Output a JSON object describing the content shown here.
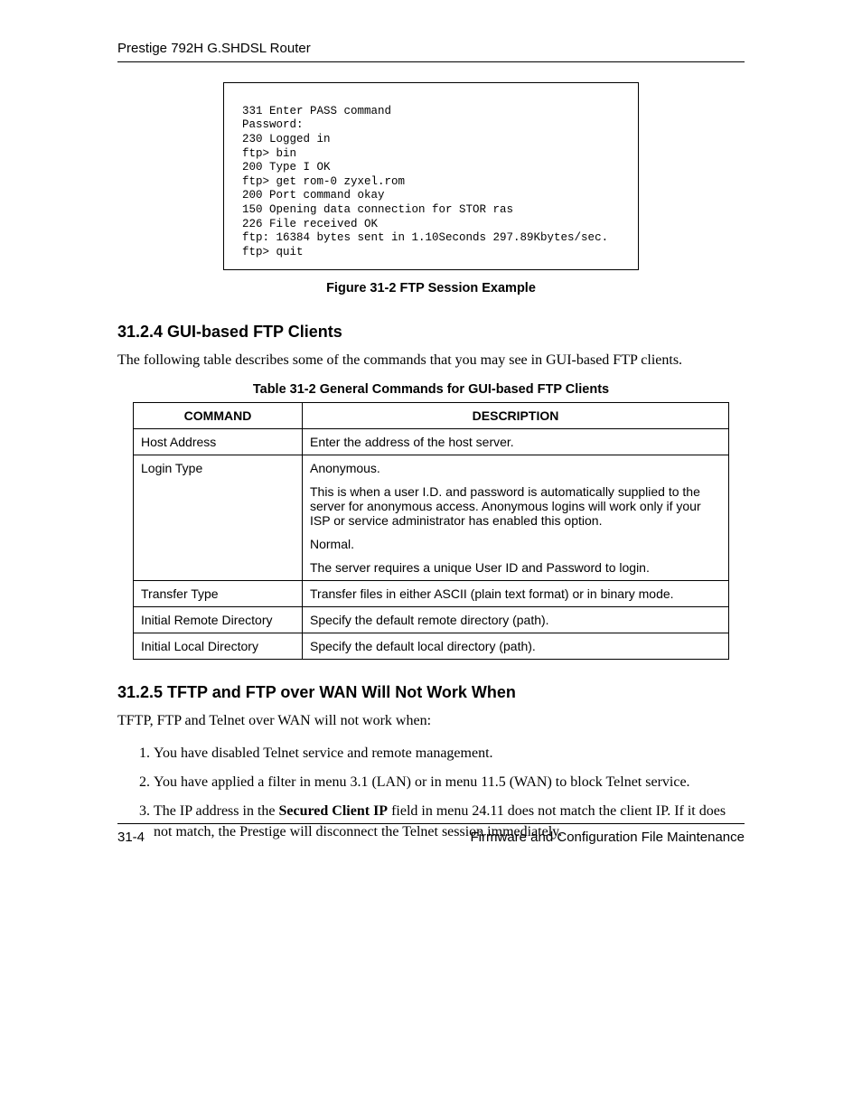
{
  "header": {
    "running_title": "Prestige 792H G.SHDSL Router"
  },
  "code_block": {
    "lines": [
      "331 Enter PASS command",
      "Password:",
      "230 Logged in",
      "ftp> bin",
      "200 Type I OK",
      "ftp> get rom-0 zyxel.rom",
      "200 Port command okay",
      "150 Opening data connection for STOR ras",
      "226 File received OK",
      "ftp: 16384 bytes sent in 1.10Seconds 297.89Kbytes/sec.",
      "ftp> quit"
    ]
  },
  "figure_caption": "Figure 31-2 FTP Session Example",
  "section1": {
    "heading": "31.2.4 GUI-based FTP Clients",
    "intro": "The following table describes some of the commands that you may see in GUI-based FTP clients."
  },
  "table": {
    "caption": "Table 31-2 General Commands for GUI-based FTP Clients",
    "head": {
      "col1": "COMMAND",
      "col2": "DESCRIPTION"
    },
    "rows": [
      {
        "cmd": "Host Address",
        "desc": [
          "Enter the address of the host server."
        ]
      },
      {
        "cmd": "Login Type",
        "desc": [
          "Anonymous.",
          "This is when a user I.D. and password is automatically supplied to the server for anonymous access.  Anonymous logins will work only if your ISP or service administrator has enabled this option.",
          "Normal.",
          "The server requires a unique User ID and Password to login."
        ]
      },
      {
        "cmd": "Transfer Type",
        "desc": [
          "Transfer files in either ASCII (plain text format) or in binary mode."
        ]
      },
      {
        "cmd": "Initial Remote Directory",
        "desc": [
          "Specify the default remote directory (path)."
        ]
      },
      {
        "cmd": "Initial Local Directory",
        "desc": [
          "Specify the default local directory (path)."
        ]
      }
    ]
  },
  "section2": {
    "heading": "31.2.5 TFTP and FTP over WAN Will Not Work When",
    "intro": "TFTP, FTP and Telnet over WAN will not work when:",
    "items": {
      "i1": "You have disabled Telnet service and remote management.",
      "i2": "You have applied a filter in menu 3.1 (LAN) or in menu 11.5 (WAN) to block Telnet service.",
      "i3_pre": "The IP address in the ",
      "i3_bold": "Secured Client IP",
      "i3_post": " field in menu 24.11 does not match the client IP. If it does not match, the Prestige will disconnect the Telnet session immediately."
    }
  },
  "footer": {
    "page_num": "31-4",
    "title": "Firmware and Configuration File Maintenance"
  }
}
